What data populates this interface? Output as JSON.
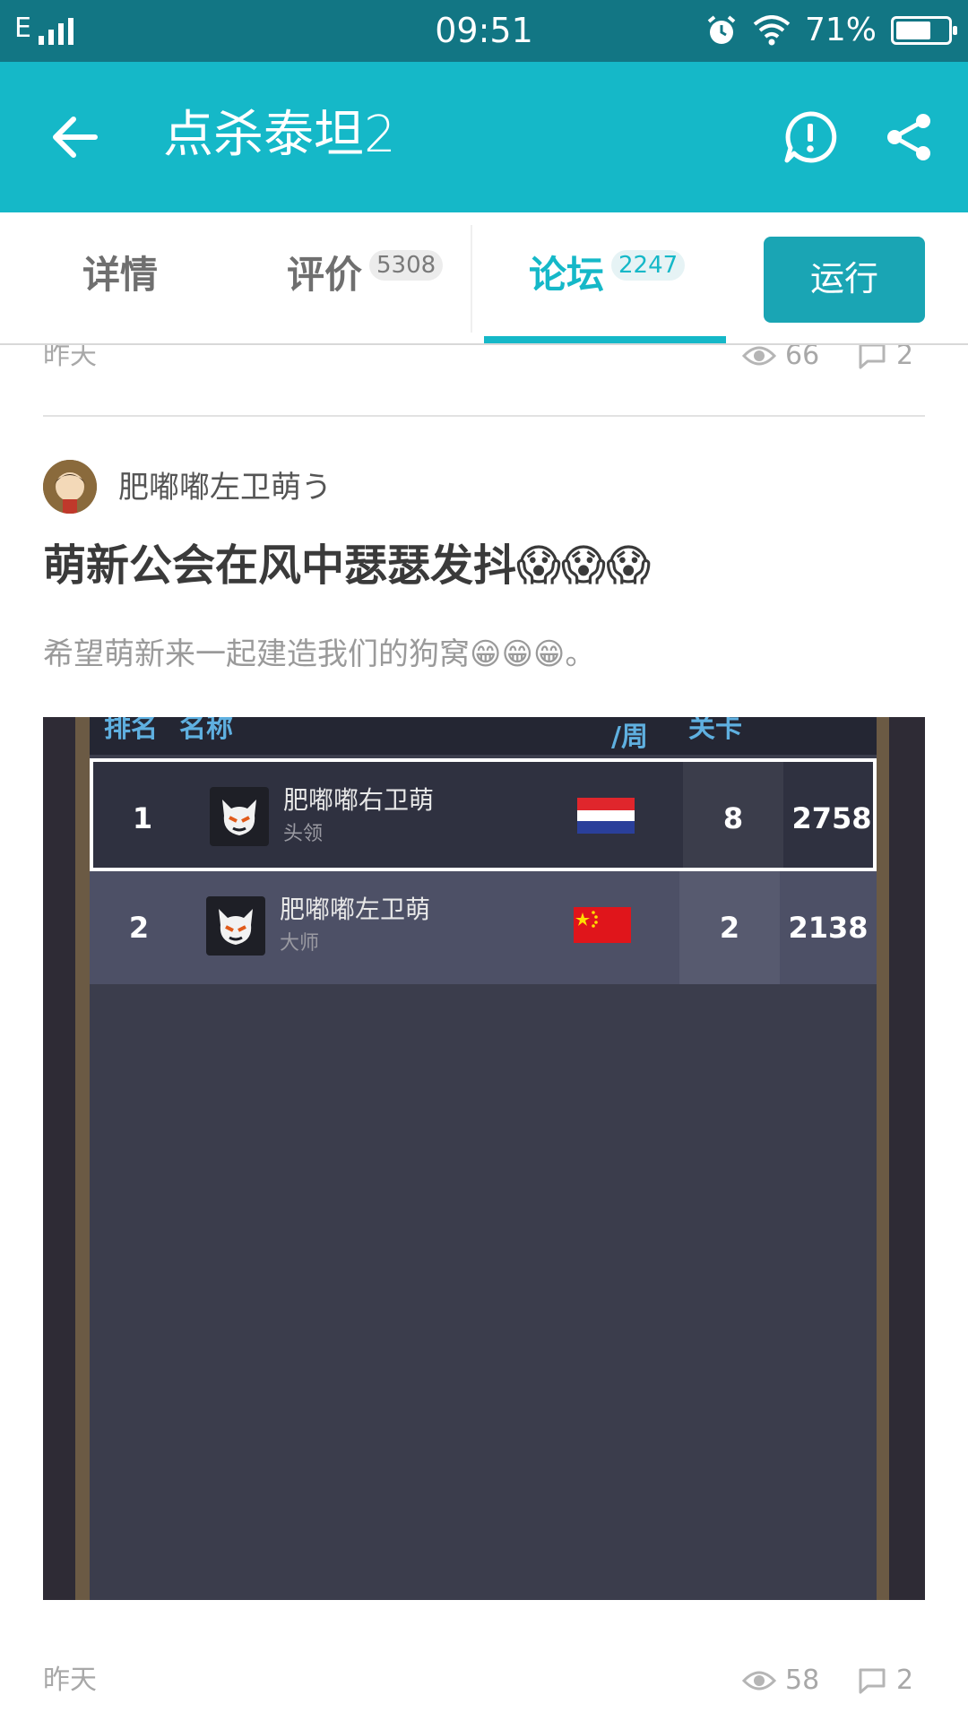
{
  "status_bar": {
    "network": "E",
    "time": "09:51",
    "battery_percent": "71%",
    "battery_level": 0.71
  },
  "app_bar": {
    "title": "点杀泰坦2",
    "back_icon": "arrow-left-icon",
    "report_icon": "exclamation-bubble-icon",
    "share_icon": "share-icon"
  },
  "tabs": [
    {
      "label": "详情",
      "count": ""
    },
    {
      "label": "评价",
      "count": "5308"
    },
    {
      "label": "论坛",
      "count": "2247",
      "active": true
    }
  ],
  "run_button": "运行",
  "prev_post": {
    "date": "昨天",
    "views": "66",
    "comments": "2"
  },
  "post": {
    "author": "肥嘟嘟左卫萌う",
    "title": "萌新公会在风中瑟瑟发抖😱😱😱",
    "body": "希望萌新来一起建造我们的狗窝😁😁😁。",
    "date": "昨天",
    "views": "58",
    "comments": "2",
    "image": {
      "headers": {
        "rank": "排名",
        "name": "名称",
        "week": "/周",
        "level": "关卡"
      },
      "rows": [
        {
          "rank": "1",
          "name": "肥嘟嘟右卫萌",
          "role": "头领",
          "week": "8",
          "level": "2758",
          "flag": "netherlands"
        },
        {
          "rank": "2",
          "name": "肥嘟嘟左卫萌",
          "role": "大师",
          "week": "2",
          "level": "2138",
          "flag": "china"
        }
      ]
    }
  },
  "colors": {
    "status_bar": "#127684",
    "app_bar": "#15b8c8",
    "accent": "#15b8c8",
    "run_button": "#1aa5b4"
  }
}
